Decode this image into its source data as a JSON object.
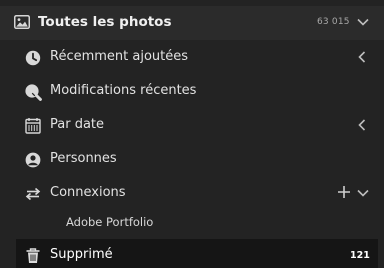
{
  "header": {
    "title": "Toutes les photos",
    "count": "63 015",
    "icon": "photo-library-icon"
  },
  "items": [
    {
      "label": "Récemment ajoutées",
      "icon": "clock-icon"
    },
    {
      "label": "Modifications récentes",
      "icon": "edit-tag-icon"
    },
    {
      "label": "Par date",
      "icon": "calendar-icon"
    },
    {
      "label": "Personnes",
      "icon": "person-icon"
    },
    {
      "label": "Connexions",
      "icon": "arrows-exchange-icon"
    }
  ],
  "connections": [
    {
      "label": "Adobe Portfolio"
    }
  ],
  "deleted": {
    "label": "Supprimé",
    "count": "121",
    "icon": "trash-icon"
  },
  "colors": {
    "background": "#232323",
    "header_background": "#2b2b2b",
    "selected_background": "#151515",
    "text": "#e2e2e2",
    "muted": "#a8a8a8"
  }
}
